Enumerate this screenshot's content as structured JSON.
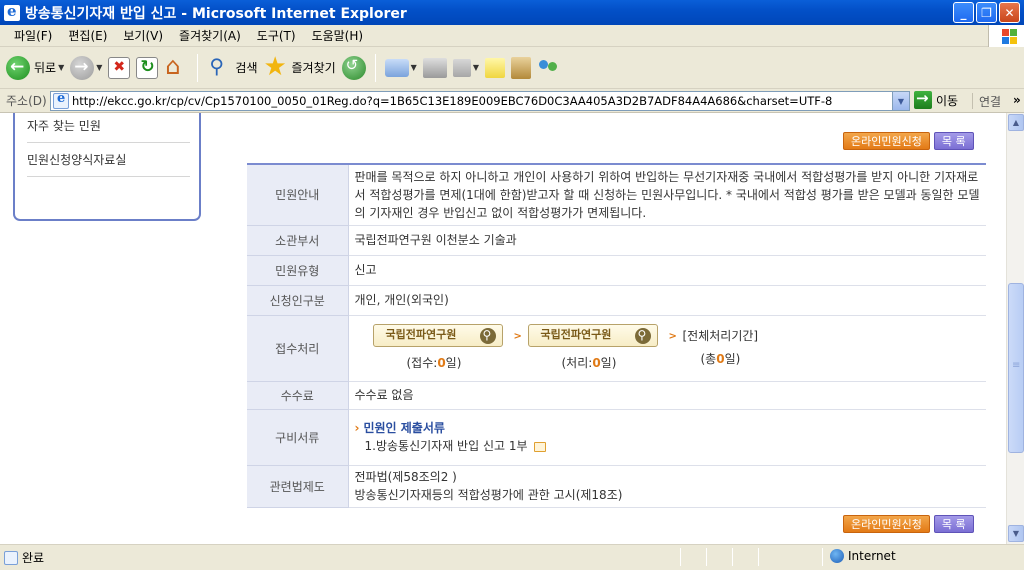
{
  "window": {
    "title": "방송통신기자재 반입 신고 - Microsoft Internet Explorer"
  },
  "menu": [
    "파일(F)",
    "편집(E)",
    "보기(V)",
    "즐겨찾기(A)",
    "도구(T)",
    "도움말(H)"
  ],
  "toolbar": {
    "back_label": "뒤로",
    "search_label": "검색",
    "favorites_label": "즐겨찾기"
  },
  "address": {
    "label": "주소(D)",
    "url": "http://ekcc.go.kr/cp/cv/Cp1570100_0050_01Reg.do?q=1B65C13E189E009EBC76D0C3AA405A3D2B7ADF84A4A686&charset=UTF-8",
    "go_label": "이동",
    "links_label": "연결"
  },
  "sidebar": {
    "items": [
      {
        "label": "자주 찾는 민원"
      },
      {
        "label": "민원신청양식자료실"
      }
    ]
  },
  "actions": {
    "apply_label": "온라인민원신청",
    "list_label": "목 록"
  },
  "info": {
    "guide": {
      "label": "민원안내",
      "text": "판매를 목적으로 하지 아니하고 개인이 사용하기 위하여 반입하는 무선기자재중 국내에서 적합성평가를 받지 아니한 기자재로서 적합성평가를 면제(1대에 한함)받고자 할 때 신청하는 민원사무입니다. * 국내에서 적합성 평가를 받은 모델과 동일한 모델의 기자재인 경우 반입신고 없이 적합성평가가 면제됩니다."
    },
    "department": {
      "label": "소관부서",
      "value": "국립전파연구원 이천분소 기술과"
    },
    "type": {
      "label": "민원유형",
      "value": "신고"
    },
    "applicant": {
      "label": "신청인구분",
      "value": "개인, 개인(외국인)"
    },
    "process": {
      "label": "접수처리",
      "receive_org": "국립전파연구원",
      "receive_prefix": "(접수:",
      "receive_days": "0",
      "process_org": "국립전파연구원",
      "process_prefix": "(처리:",
      "process_days": "0",
      "day_suffix": "일)",
      "total_label": "[전체처리기간]",
      "total_prefix": "(총",
      "total_days": "0"
    },
    "fee": {
      "label": "수수료",
      "value": "수수료 없음"
    },
    "documents": {
      "label": "구비서류",
      "subhead": "민원인 제출서류",
      "items": [
        "1.방송통신기자재 반입 신고 1부"
      ]
    },
    "law": {
      "label": "관련법제도",
      "items": [
        "전파법(제58조의2 )",
        "방송통신기자재등의 적합성평가에 관한 고시(제18조)"
      ]
    }
  },
  "status": {
    "text": "완료",
    "zone": "Internet"
  }
}
